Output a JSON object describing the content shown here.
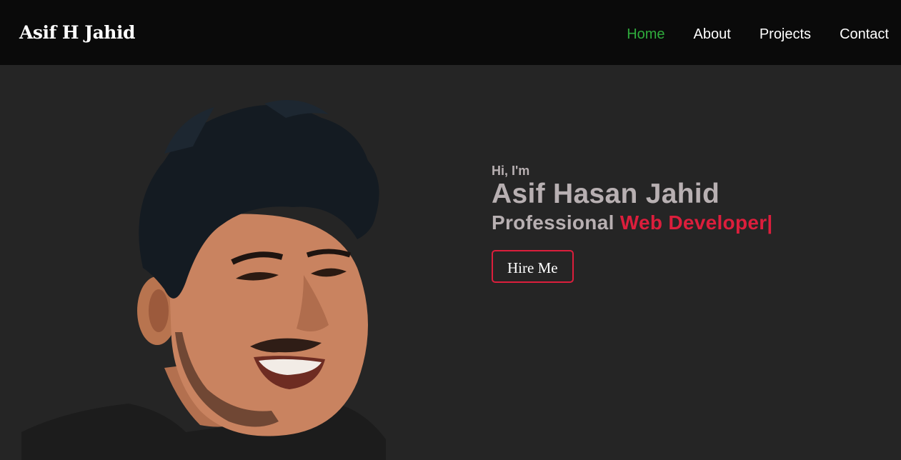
{
  "header": {
    "brand": "Asif H Jahid",
    "nav": [
      {
        "label": "Home",
        "active": true
      },
      {
        "label": "About",
        "active": false
      },
      {
        "label": "Projects",
        "active": false
      },
      {
        "label": "Contact",
        "active": false
      }
    ]
  },
  "hero": {
    "greeting": "Hi, I'm",
    "name": "Asif Hasan Jahid",
    "role_prefix": "Professional",
    "role_highlight": "Web Developer|",
    "cta_label": "Hire Me"
  },
  "colors": {
    "nav_bg": "#0a0a0a",
    "page_bg": "#252525",
    "active_link": "#2faa3c",
    "accent": "#dc1e3c",
    "muted_text": "#b8b0b2"
  }
}
